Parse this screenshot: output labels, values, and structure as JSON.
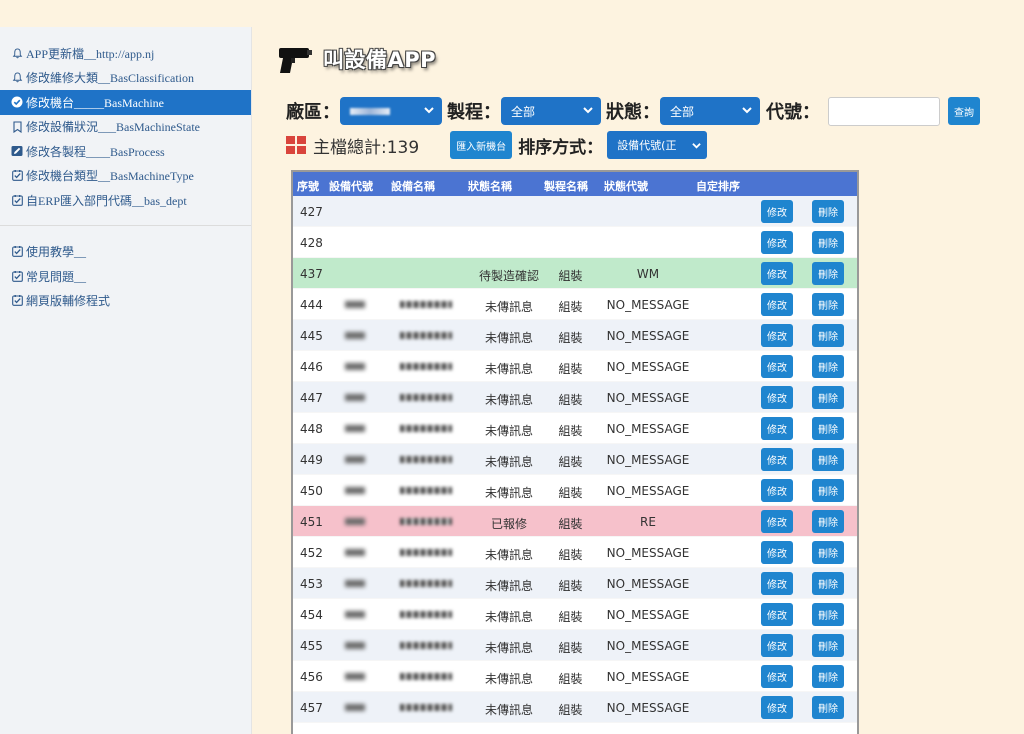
{
  "app": {
    "title": "叫設備APP"
  },
  "sidebar": {
    "primary": [
      {
        "label": "APP更新檔__http://app.nj",
        "icon": "bell-icon",
        "active": false
      },
      {
        "label": "修改維修大類__BasClassification",
        "icon": "bell-icon",
        "active": false
      },
      {
        "label": "修改機台_____BasMachine",
        "icon": "check-circle-icon",
        "active": true
      },
      {
        "label": "修改設備狀況___BasMachineState",
        "icon": "bookmark-icon",
        "active": false
      },
      {
        "label": "修改各製程____BasProcess",
        "icon": "edit-icon",
        "active": false
      },
      {
        "label": "修改機台類型__BasMachineType",
        "icon": "checkbox-icon",
        "active": false
      },
      {
        "label": "自ERP匯入部門代碼__bas_dept",
        "icon": "checkbox-icon",
        "active": false
      }
    ],
    "secondary": [
      {
        "label": "使用教學__",
        "icon": "checkbox-icon"
      },
      {
        "label": "常見問題__",
        "icon": "checkbox-icon"
      },
      {
        "label": "網頁版輔修程式",
        "icon": "checkbox-icon"
      }
    ]
  },
  "filters": {
    "factory_label": "廠區：",
    "process_label": "製程：",
    "process_value": "全部",
    "status_label": "狀態：",
    "status_value": "全部",
    "code_label": "代號：",
    "code_value": "",
    "query_button": "查詢"
  },
  "summary": {
    "total_text": "主檔總計:139",
    "import_button": "匯入新機台",
    "sort_label": "排序方式：",
    "sort_value": "設備代號(正"
  },
  "table": {
    "headers": [
      "序號",
      "設備代號",
      "設備名稱",
      "狀態名稱",
      "製程名稱",
      "狀態代號",
      "自定排序"
    ],
    "edit_label": "修改",
    "delete_label": "刪除",
    "rows": [
      {
        "seq": "427",
        "status_name": "",
        "process": "",
        "status_code": "",
        "style": "stripe",
        "masked": false
      },
      {
        "seq": "428",
        "status_name": "",
        "process": "",
        "status_code": "",
        "style": "plain",
        "masked": false
      },
      {
        "seq": "437",
        "status_name": "待製造確認",
        "process": "組裝",
        "status_code": "WM",
        "style": "green",
        "masked": false
      },
      {
        "seq": "444",
        "status_name": "未傳訊息",
        "process": "組裝",
        "status_code": "NO_MESSAGE",
        "style": "plain",
        "masked": true
      },
      {
        "seq": "445",
        "status_name": "未傳訊息",
        "process": "組裝",
        "status_code": "NO_MESSAGE",
        "style": "stripe",
        "masked": true
      },
      {
        "seq": "446",
        "status_name": "未傳訊息",
        "process": "組裝",
        "status_code": "NO_MESSAGE",
        "style": "plain",
        "masked": true
      },
      {
        "seq": "447",
        "status_name": "未傳訊息",
        "process": "組裝",
        "status_code": "NO_MESSAGE",
        "style": "stripe",
        "masked": true
      },
      {
        "seq": "448",
        "status_name": "未傳訊息",
        "process": "組裝",
        "status_code": "NO_MESSAGE",
        "style": "plain",
        "masked": true
      },
      {
        "seq": "449",
        "status_name": "未傳訊息",
        "process": "組裝",
        "status_code": "NO_MESSAGE",
        "style": "stripe",
        "masked": true
      },
      {
        "seq": "450",
        "status_name": "未傳訊息",
        "process": "組裝",
        "status_code": "NO_MESSAGE",
        "style": "plain",
        "masked": true
      },
      {
        "seq": "451",
        "status_name": "已報修",
        "process": "組裝",
        "status_code": "RE",
        "style": "pink",
        "masked": true
      },
      {
        "seq": "452",
        "status_name": "未傳訊息",
        "process": "組裝",
        "status_code": "NO_MESSAGE",
        "style": "plain",
        "masked": true
      },
      {
        "seq": "453",
        "status_name": "未傳訊息",
        "process": "組裝",
        "status_code": "NO_MESSAGE",
        "style": "stripe",
        "masked": true
      },
      {
        "seq": "454",
        "status_name": "未傳訊息",
        "process": "組裝",
        "status_code": "NO_MESSAGE",
        "style": "plain",
        "masked": true
      },
      {
        "seq": "455",
        "status_name": "未傳訊息",
        "process": "組裝",
        "status_code": "NO_MESSAGE",
        "style": "stripe",
        "masked": true
      },
      {
        "seq": "456",
        "status_name": "未傳訊息",
        "process": "組裝",
        "status_code": "NO_MESSAGE",
        "style": "plain",
        "masked": true
      },
      {
        "seq": "457",
        "status_name": "未傳訊息",
        "process": "組裝",
        "status_code": "NO_MESSAGE",
        "style": "stripe",
        "masked": true
      }
    ]
  },
  "colors": {
    "primary_button": "#1f85cf",
    "table_header": "#4b74d2",
    "row_green": "#c0eacb",
    "row_pink": "#f6c1cb",
    "page_bg": "#fdf3e0"
  }
}
